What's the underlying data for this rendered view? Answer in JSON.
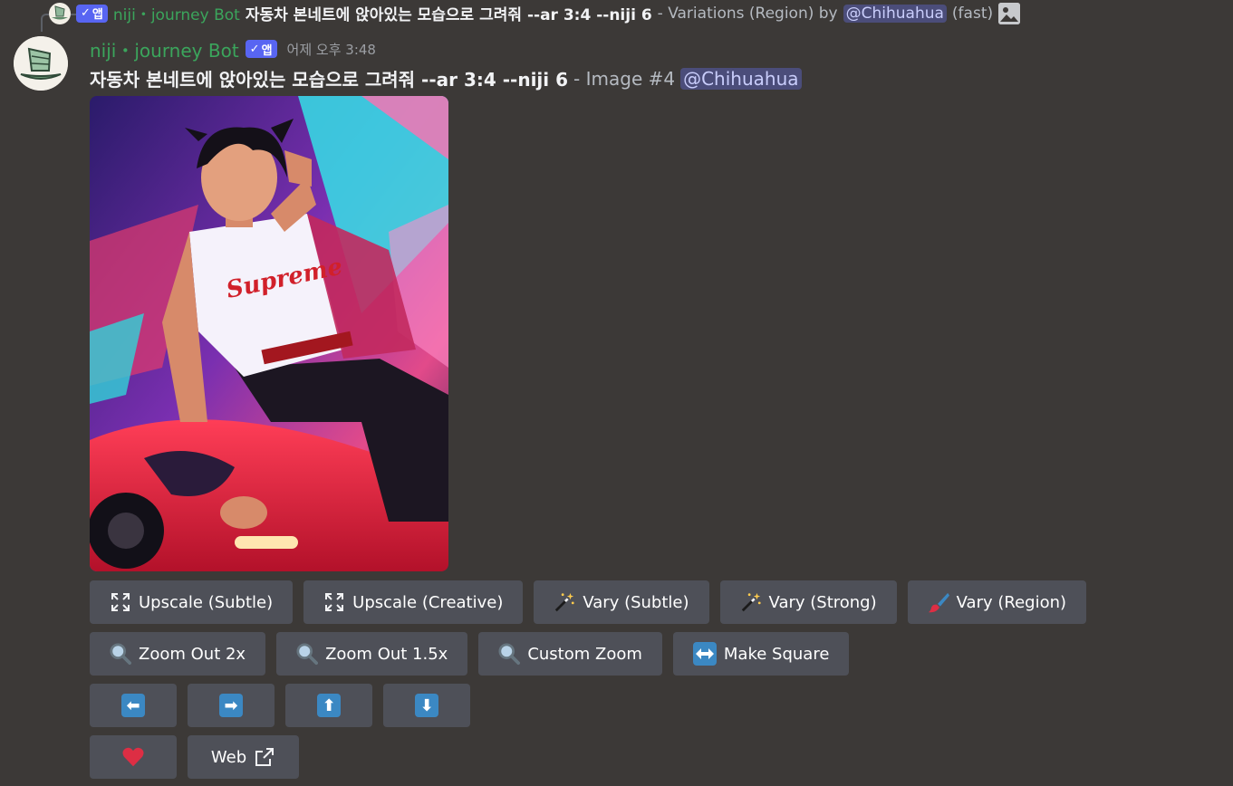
{
  "reply": {
    "bot_name": "niji・journey Bot",
    "app_badge": "앱",
    "prompt": "자동차 본네트에 앉아있는 모습으로 그려줘 --ar 3:4 --niji 6",
    "suffix": "- Variations (Region) by",
    "mention": "@Chihuahua",
    "speed": "(fast)"
  },
  "message": {
    "bot_name": "niji・journey Bot",
    "app_badge": "앱",
    "timestamp": "어제 오후 3:48",
    "prompt": "자동차 본네트에 앉아있는 모습으로 그려줘 --ar 3:4 --niji 6",
    "suffix": "- Image #4",
    "mention": "@Chihuahua",
    "image_text": "Supreme"
  },
  "buttons": {
    "row1": [
      {
        "label": "Upscale (Subtle)",
        "icon": "expand-arrows-icon"
      },
      {
        "label": "Upscale (Creative)",
        "icon": "expand-arrows-icon"
      },
      {
        "label": "Vary (Subtle)",
        "icon": "magic-wand-icon"
      },
      {
        "label": "Vary (Strong)",
        "icon": "magic-wand-icon"
      },
      {
        "label": "Vary (Region)",
        "icon": "paintbrush-icon"
      }
    ],
    "row2": [
      {
        "label": "Zoom Out 2x",
        "icon": "magnifier-icon"
      },
      {
        "label": "Zoom Out 1.5x",
        "icon": "magnifier-icon"
      },
      {
        "label": "Custom Zoom",
        "icon": "magnifier-icon"
      },
      {
        "label": "Make Square",
        "icon": "left-right-arrow-icon"
      }
    ],
    "row3": [
      {
        "icon": "arrow-left-icon",
        "glyph": "⬅"
      },
      {
        "icon": "arrow-right-icon",
        "glyph": "➡"
      },
      {
        "icon": "arrow-up-icon",
        "glyph": "⬆"
      },
      {
        "icon": "arrow-down-icon",
        "glyph": "⬇"
      }
    ],
    "row4": {
      "web_label": "Web"
    }
  },
  "colors": {
    "background": "#3c3937",
    "button": "#4e5058",
    "bot_name": "#3ba55c",
    "app_badge": "#5865f2",
    "mention_bg": "#4b4d7a",
    "emoji_blue": "#3b88c3"
  }
}
